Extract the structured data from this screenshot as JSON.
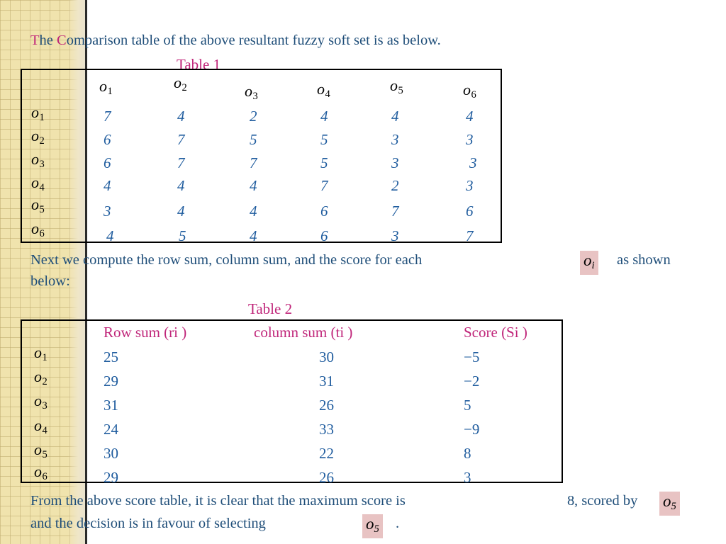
{
  "page": {
    "intro_line_first_letter": "T",
    "intro_line_rest": "he ",
    "intro_line_c": "C",
    "intro_line_tail": "omparison table of the above resultant fuzzy soft set is as below."
  },
  "table1": {
    "caption": "Table 1",
    "column_headers": [
      "o1",
      "o2",
      "o3",
      "o4",
      "o5",
      "o6"
    ],
    "row_headers": [
      "o1",
      "o2",
      "o3",
      "o4",
      "o5",
      "o6"
    ],
    "rows": [
      [
        "7",
        "4",
        "2",
        "4",
        "4",
        "4"
      ],
      [
        "6",
        "7",
        "5",
        "5",
        "3",
        "3"
      ],
      [
        "6",
        "7",
        "7",
        "5",
        "3",
        "3"
      ],
      [
        "4",
        "4",
        "4",
        "7",
        "2",
        "3"
      ],
      [
        "3",
        "4",
        "4",
        "6",
        "7",
        "6"
      ],
      [
        "4",
        "5",
        "4",
        "6",
        "3",
        "7"
      ]
    ]
  },
  "middle_text": {
    "part1": "Next we compute the row sum, column sum, and the score for each",
    "token": "oi",
    "part2": "as shown",
    "part3": "below:"
  },
  "table2": {
    "caption": "Table 2",
    "column_headers": [
      "Row sum (ri )",
      "column sum (ti )",
      "Score (Si )"
    ],
    "row_headers": [
      "o1",
      "o2",
      "o3",
      "o4",
      "o5",
      "o6"
    ],
    "rows": [
      [
        "25",
        "30",
        "−5"
      ],
      [
        "29",
        "31",
        "−2"
      ],
      [
        "31",
        "26",
        "5"
      ],
      [
        "24",
        "33",
        "−9"
      ],
      [
        "30",
        "22",
        "8"
      ],
      [
        "29",
        "26",
        "3"
      ]
    ]
  },
  "closing_text": {
    "part1": "From the above score table, it is clear that the maximum score is",
    "max_score": "8",
    "part2": ", scored by",
    "token1": "o5",
    "part3": "and the decision is in favour of selecting",
    "token2": "o5",
    "part4": "."
  }
}
